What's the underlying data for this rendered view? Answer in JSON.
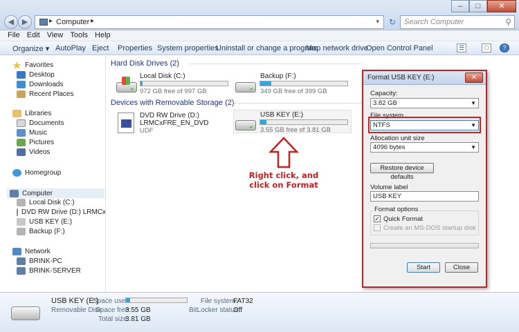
{
  "address": {
    "crumb": "Computer"
  },
  "search": {
    "placeholder": "Search Computer"
  },
  "menu": [
    "File",
    "Edit",
    "View",
    "Tools",
    "Help"
  ],
  "toolbar": [
    "Organize ▾",
    "AutoPlay",
    "Eject",
    "Properties",
    "System properties",
    "Uninstall or change a program",
    "Map network drive",
    "Open Control Panel"
  ],
  "nav": {
    "favorites": "Favorites",
    "desktop": "Desktop",
    "downloads": "Downloads",
    "recent": "Recent Places",
    "libraries": "Libraries",
    "documents": "Documents",
    "music": "Music",
    "pictures": "Pictures",
    "videos": "Videos",
    "homegroup": "Homegroup",
    "computer": "Computer",
    "localdisk": "Local Disk (C:)",
    "dvd": "DVD RW Drive (D:) LRMCxFRE_E",
    "usb": "USB KEY (E:)",
    "backup": "Backup (F:)",
    "network": "Network",
    "pc1": "BRINK-PC",
    "pc2": "BRINK-SERVER"
  },
  "content": {
    "hdd_group": "Hard Disk Drives (2)",
    "rem_group": "Devices with Removable Storage (2)",
    "local": {
      "name": "Local Disk (C:)",
      "free": "972 GB free of 997 GB",
      "used_fraction": 0.025
    },
    "backup": {
      "name": "Backup (F:)",
      "free": "349 GB free of 399 GB",
      "used_fraction": 0.125
    },
    "dvd": {
      "name": "DVD RW Drive (D:)",
      "label": "LRMCxFRE_EN_DVD",
      "fs": "UDF"
    },
    "usb": {
      "name": "USB KEY (E:)",
      "free": "3.55 GB free of 3.81 GB",
      "used_fraction": 0.068
    }
  },
  "callout": {
    "line1": "Right click, and",
    "line2": "click on Format"
  },
  "details": {
    "name": "USB KEY (E:)",
    "type": "Removable Disk",
    "space_used_label": "Space used:",
    "space_free_label": "Space free:",
    "space_free": "3.55 GB",
    "total_label": "Total size:",
    "total": "3.81 GB",
    "fs_label": "File system:",
    "fs": "FAT32",
    "bitlocker_label": "BitLocker status:",
    "bitlocker": "Off",
    "used_fraction": 0.068
  },
  "dialog": {
    "title": "Format USB KEY (E:)",
    "capacity_label": "Capacity:",
    "capacity": "3.82 GB",
    "fs_label": "File system",
    "fs": "NTFS",
    "alloc_label": "Allocation unit size",
    "alloc": "4096 bytes",
    "restore": "Restore device defaults",
    "volume_label": "Volume label",
    "volume": "USB KEY",
    "options_label": "Format options",
    "quick": "Quick Format",
    "msdos": "Create an MS-DOS startup disk",
    "start": "Start",
    "close": "Close"
  },
  "colors": {
    "accent": "#2aa8e0",
    "highlight": "#d12121",
    "group": "#1e3287"
  }
}
